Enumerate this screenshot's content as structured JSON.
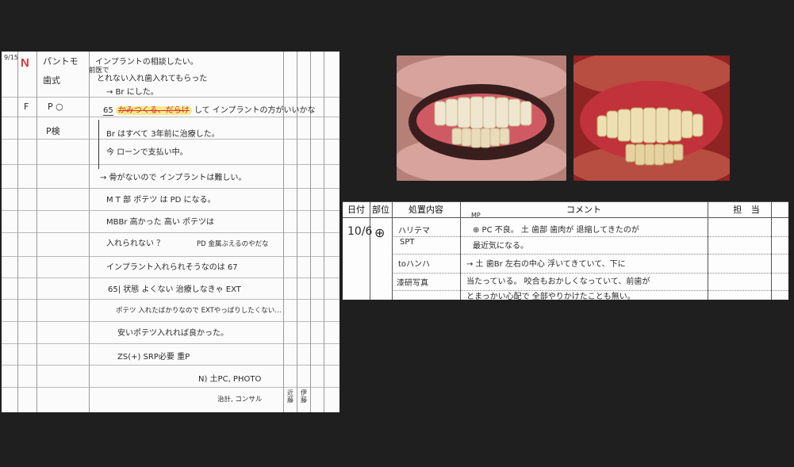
{
  "left_sheet": {
    "date": "9/15",
    "mark": "N",
    "row1": {
      "col1_line1": "パントモ",
      "col1_line2": "歯式",
      "line1": "インプラントの相談したい。",
      "line2_prefix": "前医で",
      "line2": "とれない入れ歯入れてもらった",
      "line3": "→ Br にした。"
    },
    "row2": {
      "letter": "F",
      "col1": "P ○",
      "tooth_no": "65",
      "struck": "かみつくる、だらけ",
      "line1_rest": "して インプラントの方がいいかな"
    },
    "row3": {
      "col1": "P検",
      "line1": "Br はすべて 3年前に治療した。",
      "line2": "今 ローンで支払い中。"
    },
    "lines": [
      "→ 骨がないので インプラントは難しい。",
      "M T 部 ポテツ は PD になる。",
      "MBBr 高かった     高い ポテツは",
      "入れられない ？",
      "インプラント入れられそうなのは 67",
      "65| 状態 よくない 治療しなきゃ EXT",
      "ポテツ 入れたばかりなので EXTやっぱりしたくない…",
      "安いポテツ入れれば良かった。",
      "ZS(+)   SRP必要   重P",
      "N)  土PC, PHOTO",
      "治計, コンサル"
    ],
    "side_note": "PD 金属ぶえるのやだな",
    "stamp1": "近藤",
    "stamp2": "伊藤"
  },
  "photos": {
    "left": "intraoral-photo-teeth-pale-gums",
    "right": "intraoral-photo-teeth-red-gums"
  },
  "record": {
    "headers": [
      "日付",
      "部位",
      "処置内容",
      "コメント",
      "担 当"
    ],
    "date": "10/6",
    "site_symbol": "⊕",
    "treatments": [
      "ハリテマ",
      "SPT",
      "toハンハ",
      "漆研写真"
    ],
    "note_top": "MP",
    "comments": [
      "⊕ PC 不良。 土 歯部 歯肉が 退縮してきたのが",
      "最近気になる。",
      "→ 土 歯Br 左右の中心 浮いてきていて、下に",
      "当たっている。 咬合もおかしくなっていて、前歯が",
      "とまっかい心配で 全部やりかけたことも無い。"
    ]
  }
}
